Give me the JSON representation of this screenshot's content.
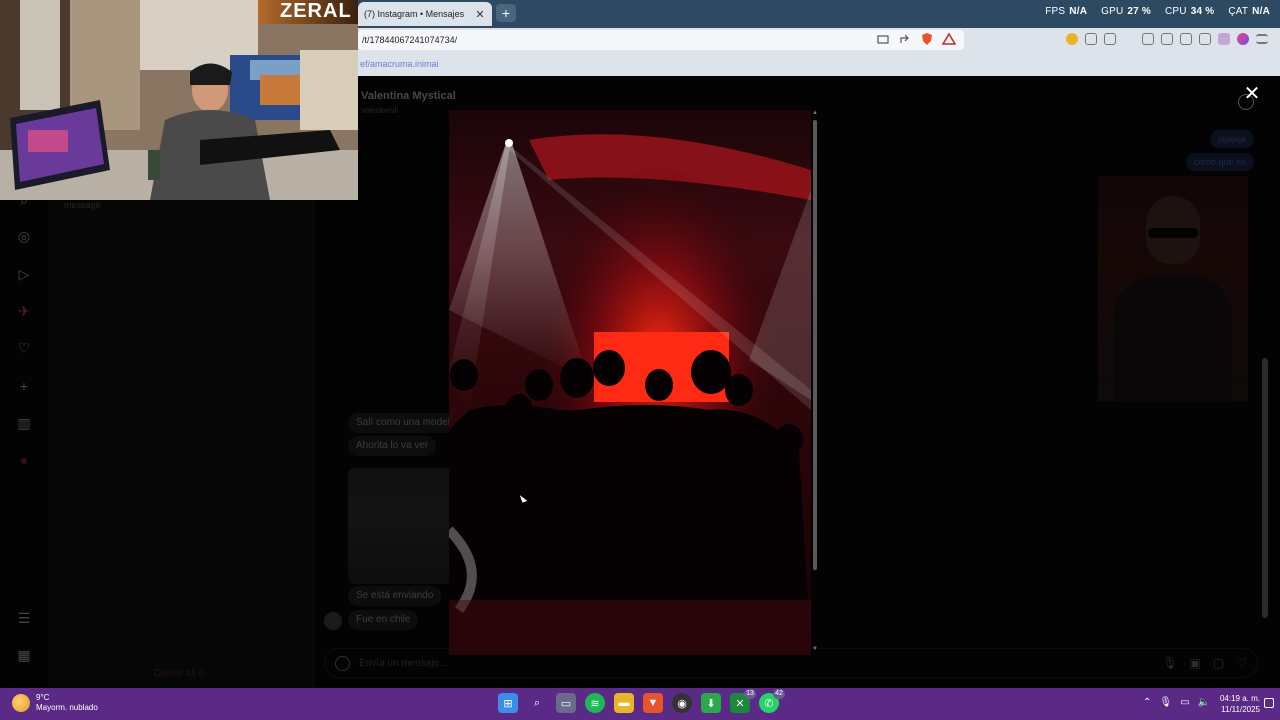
{
  "browser": {
    "tab_title": "(7) Instagram • Mensajes",
    "tab_close": "✕",
    "new_tab": "+",
    "url": "/t/17844067241074734/",
    "bookmark_text": "ef/amacruma.inimai"
  },
  "stats": {
    "fps_label": "FPS",
    "fps_value": "N/A",
    "gpu_label": "GPU",
    "gpu_value": "27 %",
    "cpu_label": "CPU",
    "cpu_value": "34 %",
    "bat_label": "ÇAT",
    "bat_value": "N/A"
  },
  "webcam": {
    "overlay_text": "ZERAL"
  },
  "inbox": {
    "message_hint": "message",
    "delete_all": "Delete all 0"
  },
  "chat": {
    "contact_name": "Valentina Mystical",
    "contact_user": "valeakenili",
    "outgoing": [
      "jajajaja",
      "como que no"
    ],
    "incoming": [
      "Salí como una modelí",
      "Ahorita lo va ver",
      "Se está enviando",
      "Fue en chile"
    ],
    "composer_placeholder": "Envía un mensaje..."
  },
  "viewer": {
    "close_label": "✕"
  },
  "taskbar": {
    "weather_temp": "9°C",
    "weather_desc": "Mayorm. nublado",
    "clock_time": "04:19 a. m.",
    "clock_date": "11/11/2025",
    "badge_xbox": "13",
    "badge_whatsapp": "42"
  },
  "colors": {
    "taskbar": "#5b2a86",
    "tabbar": "#2e4a63",
    "chrome": "#dde3ea",
    "page_bg": "#0c0c0c"
  }
}
